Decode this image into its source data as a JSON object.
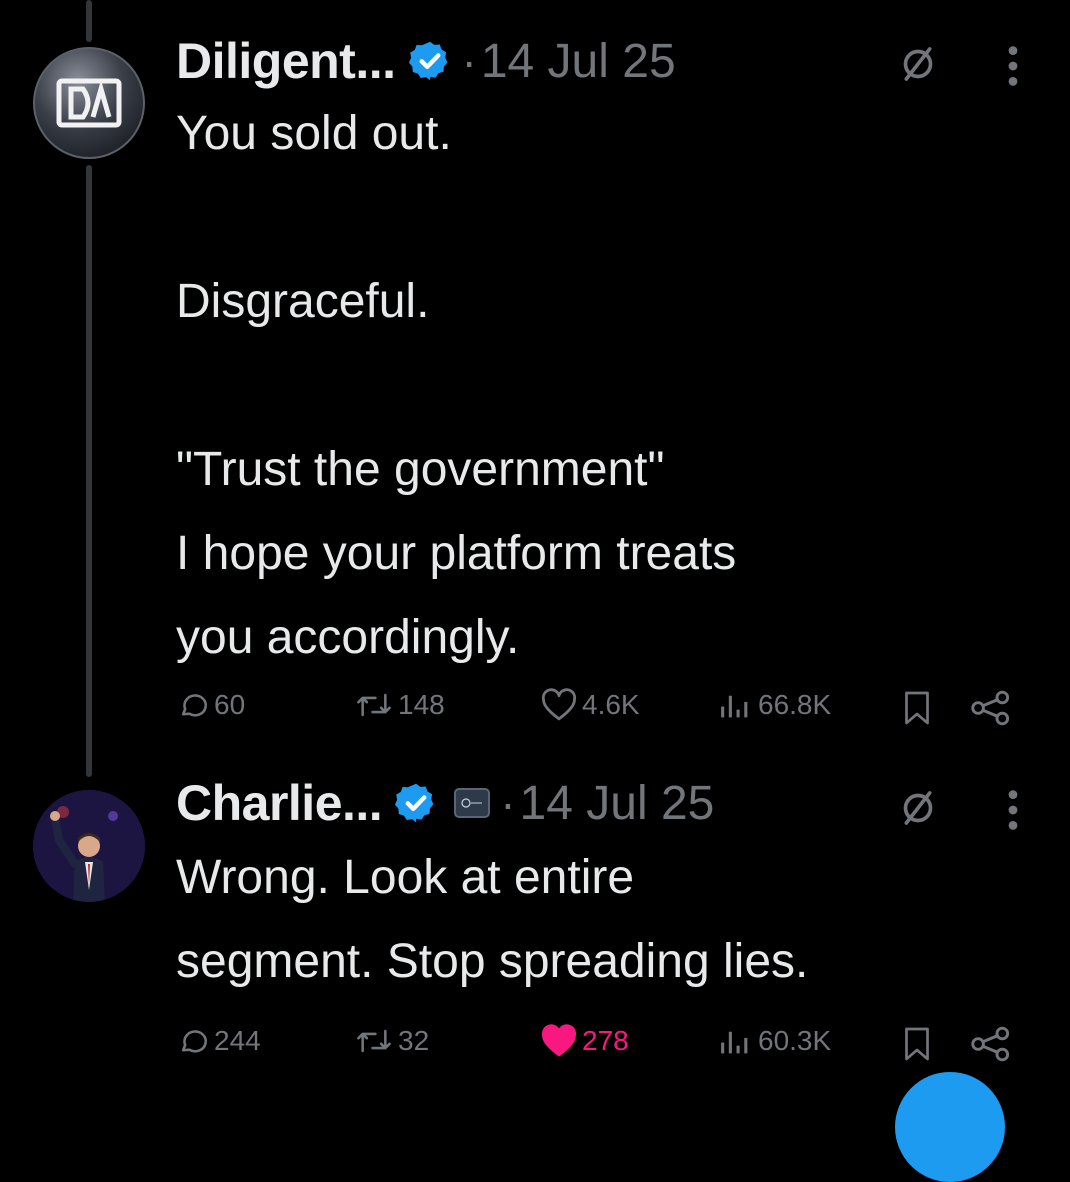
{
  "tweets": [
    {
      "author_name": "Diligent...",
      "date": "14 Jul 25",
      "dot": "·",
      "avatar": "diligent-logo-avatar",
      "body_lines": [
        "You sold out.",
        "",
        "Disgraceful.",
        "",
        "\"Trust the government\"",
        "I hope your platform treats",
        "you accordingly."
      ],
      "replies": "60",
      "reposts": "148",
      "likes": "4.6K",
      "views": "66.8K",
      "liked": false
    },
    {
      "author_name": "Charlie...",
      "date": "14 Jul 25",
      "dot": "·",
      "avatar": "person-photo-avatar",
      "body_lines": [
        "Wrong. Look at entire",
        "segment. Stop spreading lies."
      ],
      "replies": "244",
      "reposts": "32",
      "likes": "278",
      "views": "60.3K",
      "liked": true
    }
  ],
  "colors": {
    "background": "#000000",
    "text": "#e7e9ea",
    "muted": "#71767b",
    "verified": "#1d9bf0",
    "like": "#f91880"
  },
  "icons": [
    "reply-icon",
    "repost-icon",
    "like-icon",
    "views-icon",
    "bookmark-icon",
    "share-icon",
    "verified-badge-icon",
    "grok-icon",
    "more-icon"
  ]
}
